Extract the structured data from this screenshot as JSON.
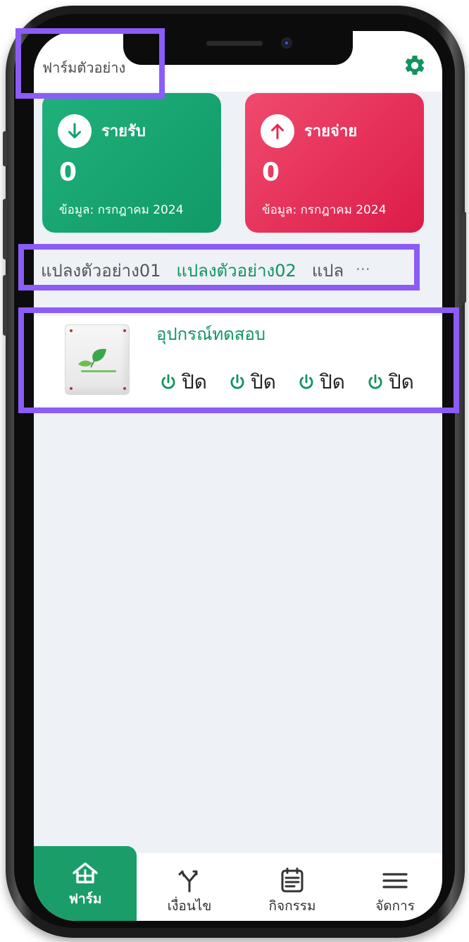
{
  "header": {
    "farm_name": "ฟาร์มตัวอย่าง"
  },
  "summary": {
    "income": {
      "label": "รายรับ",
      "amount": "0",
      "date_note": "ข้อมูล: กรกฎาคม 2024",
      "color": "#12a06c"
    },
    "expense": {
      "label": "รายจ่าย",
      "amount": "0",
      "date_note": "ข้อมูล: กรกฎาคม 2024",
      "color": "#e8294f"
    }
  },
  "plots": {
    "tabs": [
      {
        "label": "แปลงตัวอย่าง01"
      },
      {
        "label": "แปลงตัวอย่าง02"
      },
      {
        "label": "แปล"
      }
    ],
    "more": "..."
  },
  "device": {
    "name": "อุปกรณ์ทดสอบ",
    "switches": [
      {
        "label": "ปิด"
      },
      {
        "label": "ปิด"
      },
      {
        "label": "ปิด"
      },
      {
        "label": "ปิด"
      }
    ]
  },
  "nav": {
    "items": [
      {
        "label": "ฟาร์ม",
        "icon": "home-icon"
      },
      {
        "label": "เงื่อนไข",
        "icon": "fork-icon"
      },
      {
        "label": "กิจกรรม",
        "icon": "calendar-icon"
      },
      {
        "label": "จัดการ",
        "icon": "menu-icon"
      }
    ]
  },
  "colors": {
    "accent": "#12935f",
    "highlight": "#8b5cf6"
  }
}
